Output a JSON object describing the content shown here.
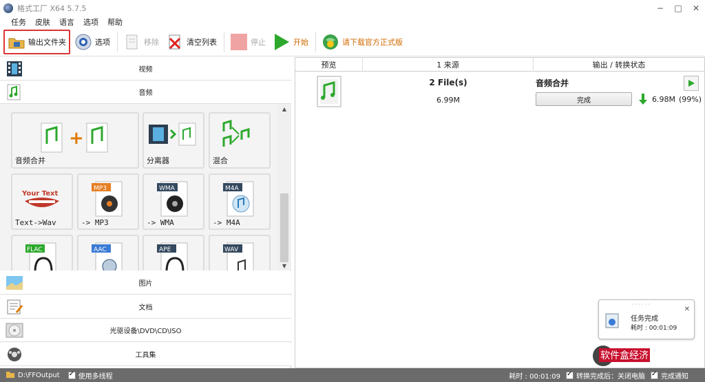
{
  "app": {
    "title": "格式工厂 X64 5.7.5"
  },
  "window_controls": {
    "minimize": "−",
    "maximize": "□",
    "close": "✕"
  },
  "menu": [
    "任务",
    "皮肤",
    "语言",
    "选项",
    "帮助"
  ],
  "toolbar": {
    "output_folder": "输出文件夹",
    "options": "选项",
    "remove": "移除",
    "clear_list": "清空列表",
    "stop": "停止",
    "start": "开始",
    "download": "请下载官方正式版"
  },
  "categories": {
    "video": "视频",
    "audio": "音频",
    "picture": "图片",
    "document": "文档",
    "disc": "光驱设备\\DVD\\CD\\ISO",
    "toolbox": "工具集"
  },
  "tiles": [
    {
      "label": "音频合并",
      "icon": "audio-merge-icon"
    },
    {
      "label": "分离器",
      "icon": "splitter-icon"
    },
    {
      "label": "混合",
      "icon": "mix-icon"
    },
    {
      "label": "Text->Wav",
      "icon": "text-to-wav-icon",
      "badge": "Your Text"
    },
    {
      "label": "-> MP3",
      "icon": "mp3-icon",
      "badge": "MP3"
    },
    {
      "label": "-> WMA",
      "icon": "wma-icon",
      "badge": "WMA"
    },
    {
      "label": "-> M4A",
      "icon": "m4a-icon",
      "badge": "M4A"
    },
    {
      "label": "",
      "icon": "flac-icon",
      "badge": "FLAC"
    },
    {
      "label": "",
      "icon": "aac-icon",
      "badge": "AAC"
    },
    {
      "label": "",
      "icon": "ape-icon",
      "badge": "APE"
    },
    {
      "label": "",
      "icon": "wav-icon",
      "badge": "WAV"
    }
  ],
  "table": {
    "headers": [
      "预览",
      "1 来源",
      "输出 / 转换状态"
    ],
    "rows": [
      {
        "source_name": "2 File(s)",
        "source_size": "6.99M",
        "output_name": "音频合并",
        "status_button": "完成",
        "output_size": "6.98M",
        "percent": "(99%)"
      }
    ]
  },
  "notification": {
    "title": "任务完成",
    "time": "耗时 : 00:01:09"
  },
  "statusbar": {
    "path": "D:\\FFOutput",
    "multithread": "使用多线程",
    "elapsed": "耗时 : 00:01:09",
    "shutdown": "转换完成后：关闭电脑",
    "notify": "完成通知"
  },
  "watermark": "软件盒经济",
  "colors": {
    "accent_green": "#2ca82c",
    "highlight_red": "#d33333"
  }
}
